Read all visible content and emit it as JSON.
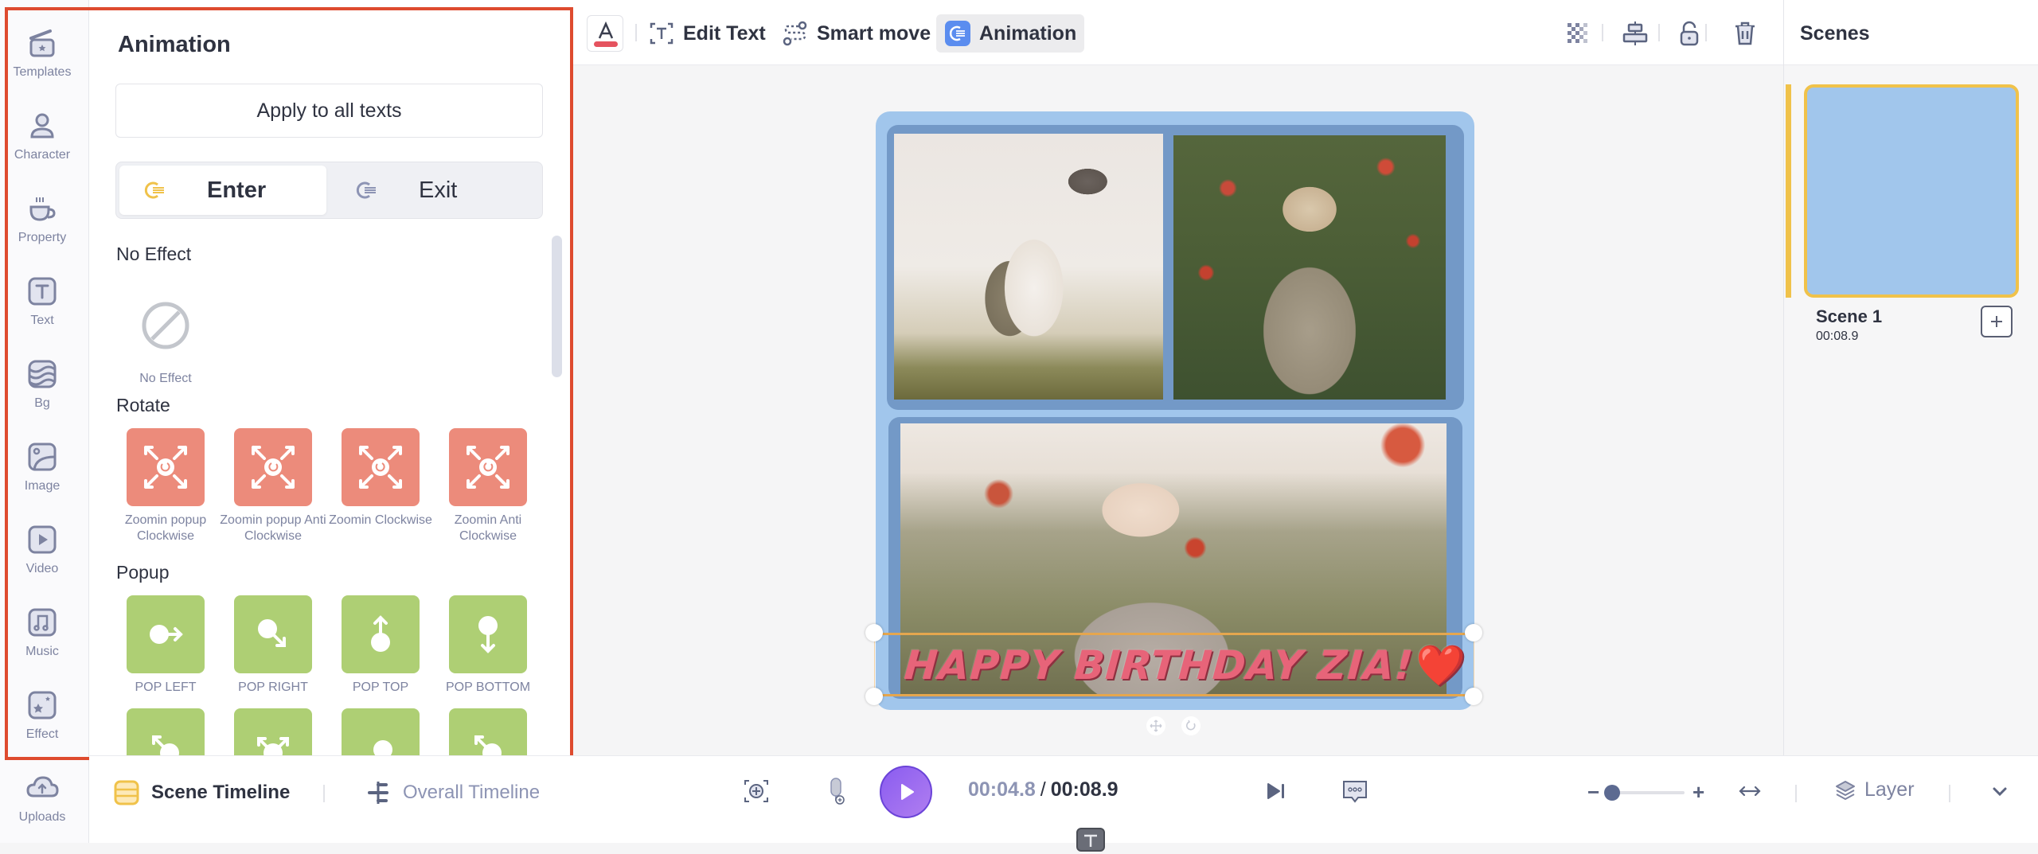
{
  "sidebar": {
    "items": [
      {
        "label": "Templates",
        "icon": "clapperboard-icon"
      },
      {
        "label": "Character",
        "icon": "person-icon"
      },
      {
        "label": "Property",
        "icon": "coffee-cup-icon"
      },
      {
        "label": "Text",
        "icon": "text-box-icon"
      },
      {
        "label": "Bg",
        "icon": "background-waves-icon"
      },
      {
        "label": "Image",
        "icon": "image-icon"
      },
      {
        "label": "Video",
        "icon": "video-play-icon"
      },
      {
        "label": "Music",
        "icon": "music-note-icon"
      },
      {
        "label": "Effect",
        "icon": "sparkle-stars-icon"
      }
    ],
    "uploads": {
      "label": "Uploads",
      "icon": "cloud-upload-icon"
    }
  },
  "panel": {
    "title": "Animation",
    "apply_all_label": "Apply to all texts",
    "tabs": [
      {
        "label": "Enter",
        "active": true,
        "icon_color": "#f0c24a"
      },
      {
        "label": "Exit",
        "active": false,
        "icon_color": "#8d94b4"
      }
    ],
    "sections": {
      "no_effect": {
        "title": "No Effect",
        "items": [
          {
            "label": "No Effect"
          }
        ]
      },
      "rotate": {
        "title": "Rotate",
        "color": "#ec8b7b",
        "items": [
          {
            "label": "Zoomin popup Clockwise"
          },
          {
            "label": "Zoomin popup Anti Clockwise"
          },
          {
            "label": "Zoomin Clockwise"
          },
          {
            "label": "Zoomin Anti Clockwise"
          }
        ]
      },
      "popup": {
        "title": "Popup",
        "color": "#aecf74",
        "items": [
          {
            "label": "POP LEFT"
          },
          {
            "label": "POP RIGHT"
          },
          {
            "label": "POP TOP"
          },
          {
            "label": "POP BOTTOM"
          }
        ]
      }
    }
  },
  "toolbar": {
    "text_color": "#e5535f",
    "text_color_letter": "A",
    "edit_text_label": "Edit Text",
    "smart_move_label": "Smart move",
    "animation_label": "Animation",
    "animation_active": true,
    "accent": "#5b8def"
  },
  "canvas": {
    "text": "HAPPY BIRTHDAY ZIA!",
    "emoji": "❤️",
    "text_color": "#e76479",
    "card_color": "#a1c6ec",
    "frame_color": "#7399c7",
    "selection_color": "#e5a64e"
  },
  "scenes": {
    "title": "Scenes",
    "items": [
      {
        "name": "Scene 1",
        "duration": "00:08.9",
        "selected": true
      }
    ]
  },
  "bottom": {
    "scene_timeline_label": "Scene Timeline",
    "overall_timeline_label": "Overall Timeline",
    "current_time": "00:04.8",
    "separator": "/",
    "total_time": "00:08.9",
    "zoom_minus": "−",
    "zoom_plus": "+",
    "zoom_level": 0.05,
    "layer_label": "Layer"
  }
}
